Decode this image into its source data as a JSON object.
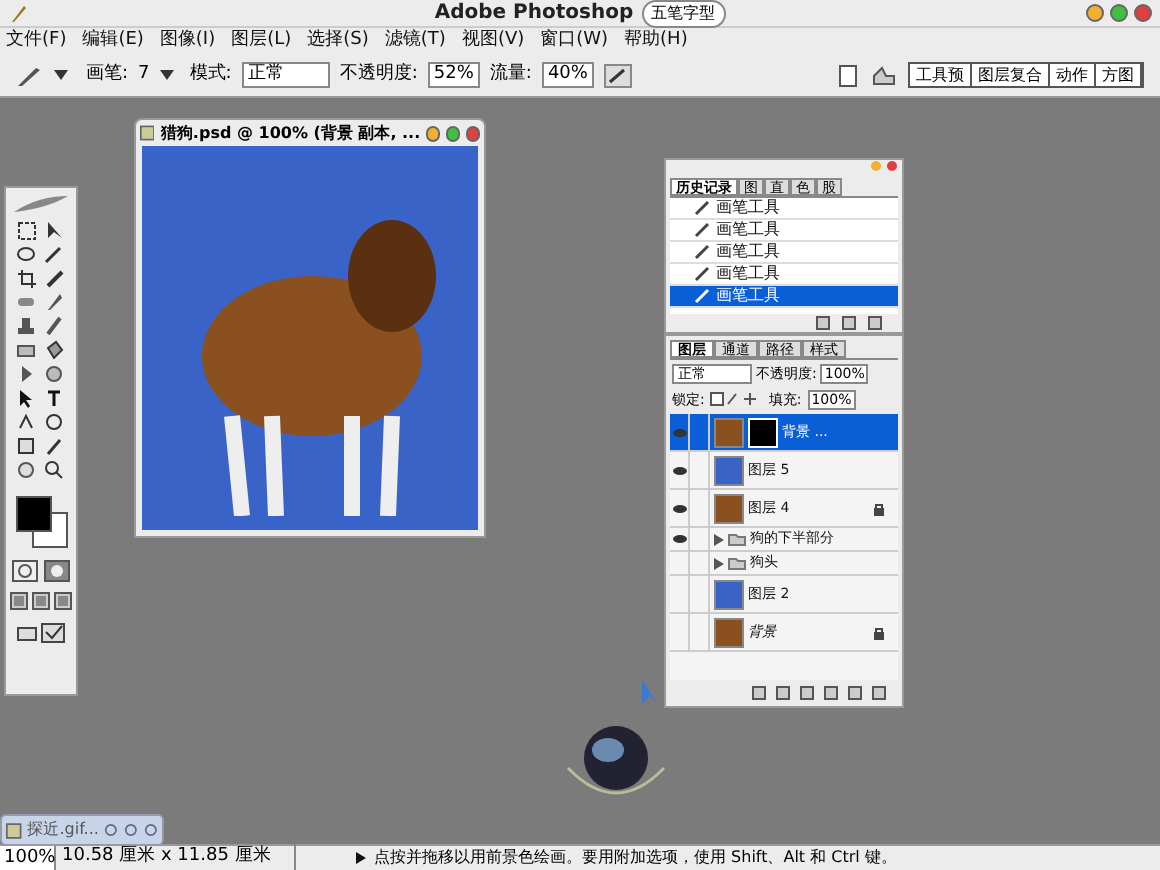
{
  "window": {
    "title": "Adobe Photoshop",
    "ime": "五笔字型"
  },
  "menu": [
    "文件(F)",
    "编辑(E)",
    "图像(I)",
    "图层(L)",
    "选择(S)",
    "滤镜(T)",
    "视图(V)",
    "窗口(W)",
    "帮助(H)"
  ],
  "options": {
    "brush_label": "画笔:",
    "brush_size": "7",
    "mode_label": "模式:",
    "mode": "正常",
    "opacity_label": "不透明度:",
    "opacity": "52%",
    "flow_label": "流量:",
    "flow": "40%"
  },
  "palette_well": [
    "工具预",
    "图层复合",
    "动作",
    "方图"
  ],
  "document": {
    "title": "猎狗.psd @ 100% (背景 副本, ..."
  },
  "history": {
    "tabs": [
      {
        "label": "历史记录",
        "selected": true
      },
      {
        "label": "图",
        "selected": false
      },
      {
        "label": "直",
        "selected": false
      },
      {
        "label": "色",
        "selected": false
      },
      {
        "label": "股",
        "selected": false
      }
    ],
    "items": [
      {
        "label": "画笔工具",
        "selected": false
      },
      {
        "label": "画笔工具",
        "selected": false
      },
      {
        "label": "画笔工具",
        "selected": false
      },
      {
        "label": "画笔工具",
        "selected": false
      },
      {
        "label": "画笔工具",
        "selected": true
      }
    ]
  },
  "layers": {
    "tabs": [
      {
        "label": "图层",
        "selected": true
      },
      {
        "label": "通道",
        "selected": false
      },
      {
        "label": "路径",
        "selected": false
      },
      {
        "label": "样式",
        "selected": false
      }
    ],
    "mode": "正常",
    "opacity_label": "不透明度:",
    "opacity": "100%",
    "lock_label": "锁定:",
    "fill_label": "填充:",
    "fill": "100%",
    "items": [
      {
        "kind": "layer",
        "name": "背景 ...",
        "visible": true,
        "locked": false,
        "selected": true,
        "mask": true
      },
      {
        "kind": "layer",
        "name": "图层 5",
        "visible": true,
        "locked": false,
        "selected": false,
        "mask": false
      },
      {
        "kind": "layer",
        "name": "图层 4",
        "visible": true,
        "locked": true,
        "selected": false,
        "mask": false
      },
      {
        "kind": "group",
        "name": "狗的下半部分",
        "visible": true,
        "locked": false,
        "selected": false,
        "mask": false
      },
      {
        "kind": "group",
        "name": "狗头",
        "visible": false,
        "locked": false,
        "selected": false,
        "mask": false
      },
      {
        "kind": "layer",
        "name": "图层 2",
        "visible": false,
        "locked": false,
        "selected": false,
        "mask": false
      },
      {
        "kind": "layer",
        "name": "背景",
        "visible": false,
        "locked": true,
        "selected": false,
        "mask": false
      }
    ]
  },
  "minimized_document": {
    "title": "探近.gif..."
  },
  "status_bar": {
    "zoom": "100%",
    "size": "10.58 厘米 x 11.85 厘米",
    "hint": "点按并拖移以用前景色绘画。要用附加选项，使用 Shift、Alt 和 Ctrl 键。"
  }
}
